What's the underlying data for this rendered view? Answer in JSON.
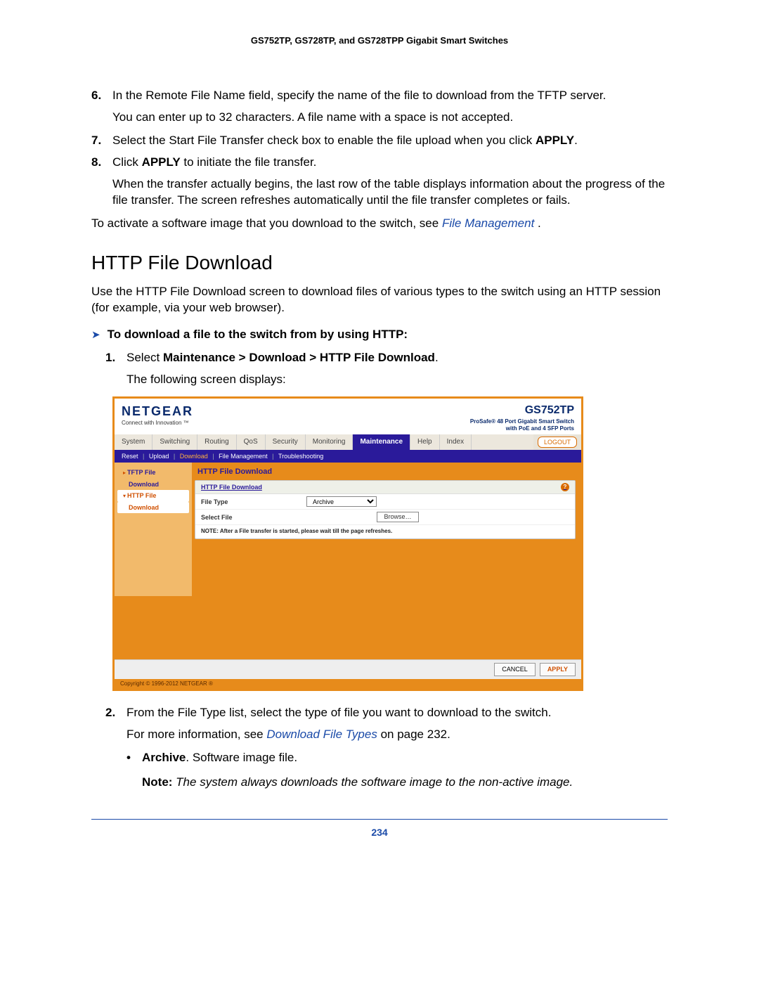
{
  "header": "GS752TP, GS728TP, and GS728TPP Gigabit Smart Switches",
  "steps_pre": [
    {
      "num": "6.",
      "text": "In the Remote File Name field, specify the name of the file to download from the TFTP server."
    }
  ],
  "pre_note": "You can enter up to 32 characters. A file name with a space is not accepted.",
  "step7": {
    "num": "7.",
    "lead": "Select the Start File Transfer check box to enable the file upload when you click ",
    "bold": "APPLY",
    "tail": "."
  },
  "step8": {
    "num": "8.",
    "lead": "Click ",
    "bold": "APPLY",
    "tail": " to initiate the file transfer."
  },
  "step8_follow": "When the transfer actually begins, the last row of the table displays information about the progress of the file transfer. The screen refreshes automatically until the file transfer completes or fails.",
  "activate_lead": "To activate a software image that you download to the switch, see ",
  "activate_link": "File Management ",
  "activate_tail": ".",
  "section_title": "HTTP File Download",
  "section_intro": "Use the HTTP File Download screen to download files of various types to the switch using an HTTP session (for example, via your web browser).",
  "proc_title": "To download a file to the switch from by using HTTP:",
  "proc_step1_num": "1.",
  "proc_step1_lead": "Select ",
  "proc_step1_bold": "Maintenance > Download > HTTP File Download",
  "proc_step1_tail": ".",
  "proc_step1_follow": "The following screen displays:",
  "proc_step2_num": "2.",
  "proc_step2_text": "From the File Type list, select the type of file you want to download to the switch.",
  "proc_step2_follow_lead": "For more information, see ",
  "proc_step2_follow_link": "Download File Types ",
  "proc_step2_follow_tail": "on page 232.",
  "bullet_lead": "Archive",
  "bullet_tail": ". Software image file.",
  "note_label": "Note:  ",
  "note_text": "The system always downloads the software image to the non-active image.",
  "page_number": "234",
  "shot": {
    "logo": "NETGEAR",
    "tagline": "Connect with Innovation ™",
    "model": "GS752TP",
    "model_sub1": "ProSafe® 48 Port Gigabit Smart Switch",
    "model_sub2": "with PoE and 4 SFP Ports",
    "tabs": [
      "System",
      "Switching",
      "Routing",
      "QoS",
      "Security",
      "Monitoring",
      "Maintenance",
      "Help",
      "Index"
    ],
    "active_tab": "Maintenance",
    "logout": "LOGOUT",
    "sub_items": [
      "Reset",
      "Upload",
      "Download",
      "File Management",
      "Troubleshooting"
    ],
    "sub_active": "Download",
    "side": {
      "item1": "TFTP File",
      "item1b": "Download",
      "item2": "HTTP File",
      "item2b": "Download"
    },
    "panel_title": "HTTP File Download",
    "panel_header": "HTTP File Download",
    "row1_label": "File Type",
    "row1_value": "Archive",
    "row2_label": "Select File",
    "browse": "Browse…",
    "panel_note": "NOTE: After a File transfer is started, please wait till the page refreshes.",
    "cancel": "CANCEL",
    "apply": "APPLY",
    "copyright": "Copyright © 1996-2012 NETGEAR ®"
  }
}
